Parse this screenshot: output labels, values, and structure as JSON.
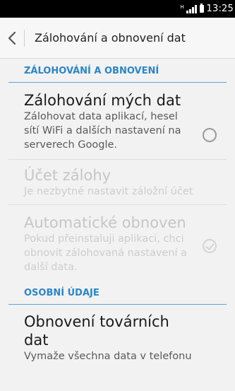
{
  "status_bar": {
    "network": "H",
    "time": "13:25"
  },
  "action_bar": {
    "title": "Zálohování a obnovení dat",
    "back_icon": "chevron-left-icon"
  },
  "sections": {
    "backup": {
      "header": "ZÁLOHOVÁNÍ A OBNOVENÍ",
      "backup_data": {
        "title": "Zálohování mých dat",
        "summary": "Zálohovat data aplikací, hesel sítí WiFi a dalších nastavení na serverech Google.",
        "checked": false
      },
      "backup_account": {
        "title": "Účet zálohy",
        "summary": "Je nezbytné nastavit záložní účet",
        "enabled": false
      },
      "auto_restore": {
        "title": "Automatické obnoven",
        "summary": "Pokud přeinstaluji aplikaci, chci obnovit zálohovaná nastavení a další data.",
        "checked": true,
        "enabled": false
      }
    },
    "personal": {
      "header": "OSOBNÍ ÚDAJE",
      "factory_reset": {
        "title": "Obnovení továrních dat",
        "summary": "Vymaže všechna data v telefonu"
      }
    }
  },
  "colors": {
    "accent": "#2a86c9",
    "divider": "#5ba6d6",
    "background": "#f2f2f2"
  }
}
